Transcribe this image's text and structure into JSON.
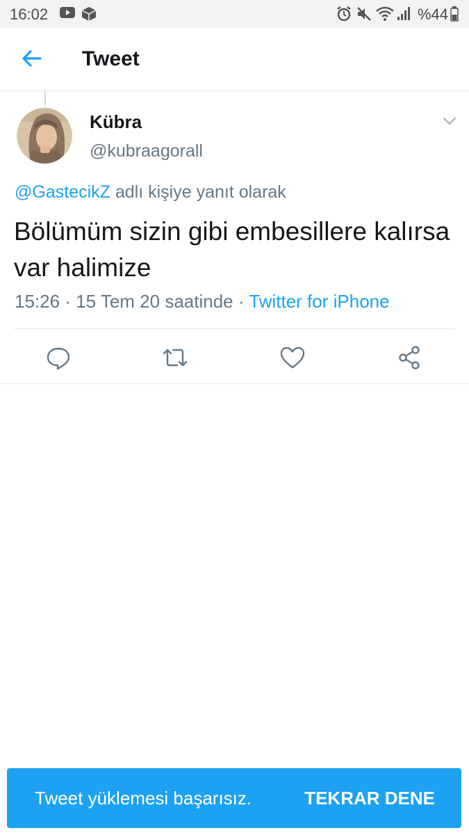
{
  "status_bar": {
    "time": "16:02",
    "battery_percent": "%44",
    "icons": [
      "youtube-icon",
      "box-icon",
      "alarm-icon",
      "mute-icon",
      "wifi-icon",
      "signal-icon",
      "battery-icon"
    ]
  },
  "header": {
    "title": "Tweet",
    "back_icon": "arrow-left-icon"
  },
  "tweet": {
    "author_name": "Kübra",
    "author_handle": "@kubraagorall",
    "reply_mention": "@GastecikZ",
    "reply_suffix": " adlı kişiye yanıt olarak",
    "text": "Bölümüm sizin gibi embesillere kalırsa var halimize",
    "timestamp": "15:26 · 15 Tem 20 saatinde · ",
    "source": "Twitter for iPhone"
  },
  "actions": [
    "reply-icon",
    "retweet-icon",
    "like-icon",
    "share-icon"
  ],
  "snackbar": {
    "message": "Tweet yüklemesi başarısız.",
    "action_label": "TEKRAR DENE"
  },
  "colors": {
    "accent": "#1da1f2",
    "secondary_text": "#657786",
    "primary_text": "#14171a"
  }
}
